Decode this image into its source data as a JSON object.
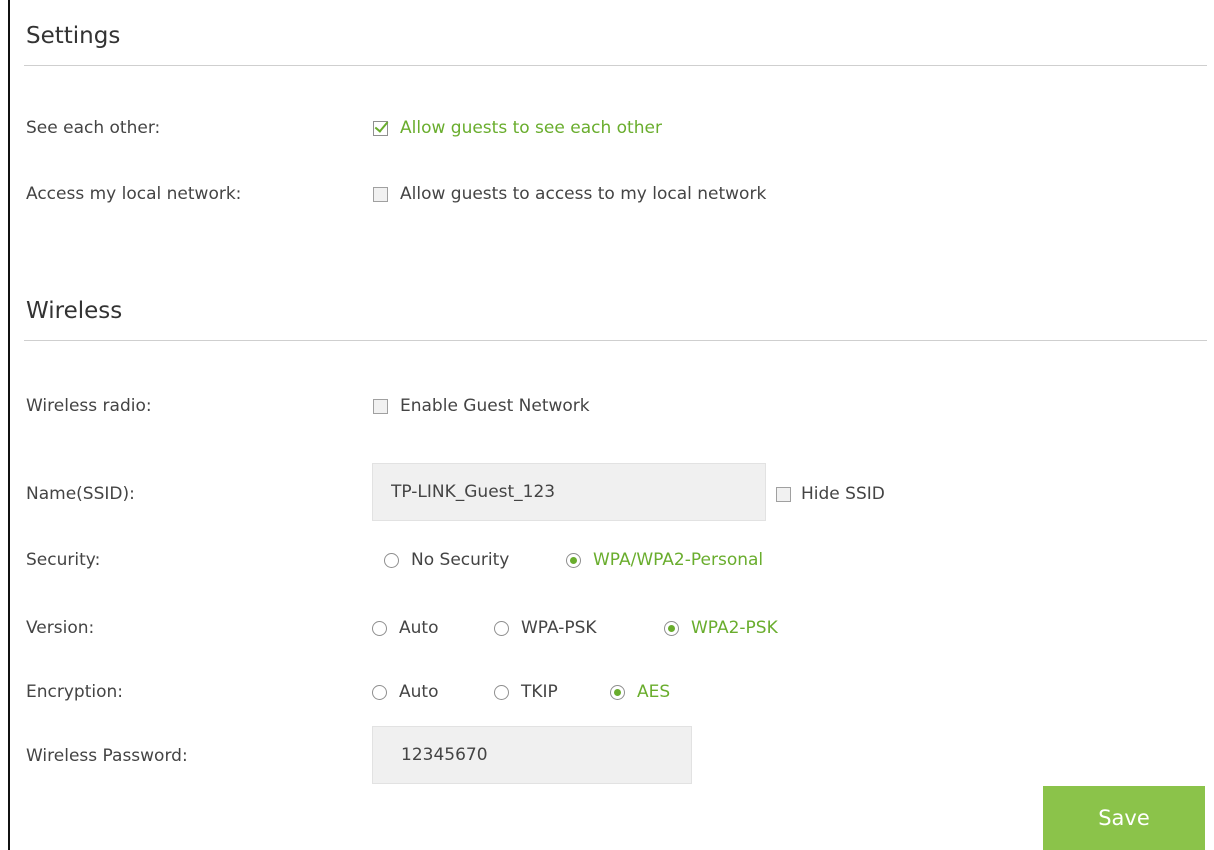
{
  "settings": {
    "title": "Settings",
    "see_each_other": {
      "label": "See each other:",
      "option": "Allow guests to see each other",
      "checked": true
    },
    "access_local": {
      "label": "Access my local network:",
      "option": "Allow guests to access to my local network",
      "checked": false
    }
  },
  "wireless": {
    "title": "Wireless",
    "radio": {
      "label": "Wireless radio:",
      "option": "Enable Guest Network",
      "checked": false
    },
    "ssid": {
      "label": "Name(SSID):",
      "value": "TP-LINK_Guest_123",
      "hide_label": "Hide SSID",
      "hide_checked": false
    },
    "security": {
      "label": "Security:",
      "options": [
        "No Security",
        "WPA/WPA2-Personal"
      ],
      "selected": "WPA/WPA2-Personal"
    },
    "version": {
      "label": "Version:",
      "options": [
        "Auto",
        "WPA-PSK",
        "WPA2-PSK"
      ],
      "selected": "WPA2-PSK"
    },
    "encryption": {
      "label": "Encryption:",
      "options": [
        "Auto",
        "TKIP",
        "AES"
      ],
      "selected": "AES"
    },
    "password": {
      "label": "Wireless Password:",
      "value": "12345670"
    }
  },
  "save_label": "Save",
  "colors": {
    "accent": "#69ad2d",
    "save_button": "#8bc34a",
    "field_bg": "#f0f0f0"
  }
}
